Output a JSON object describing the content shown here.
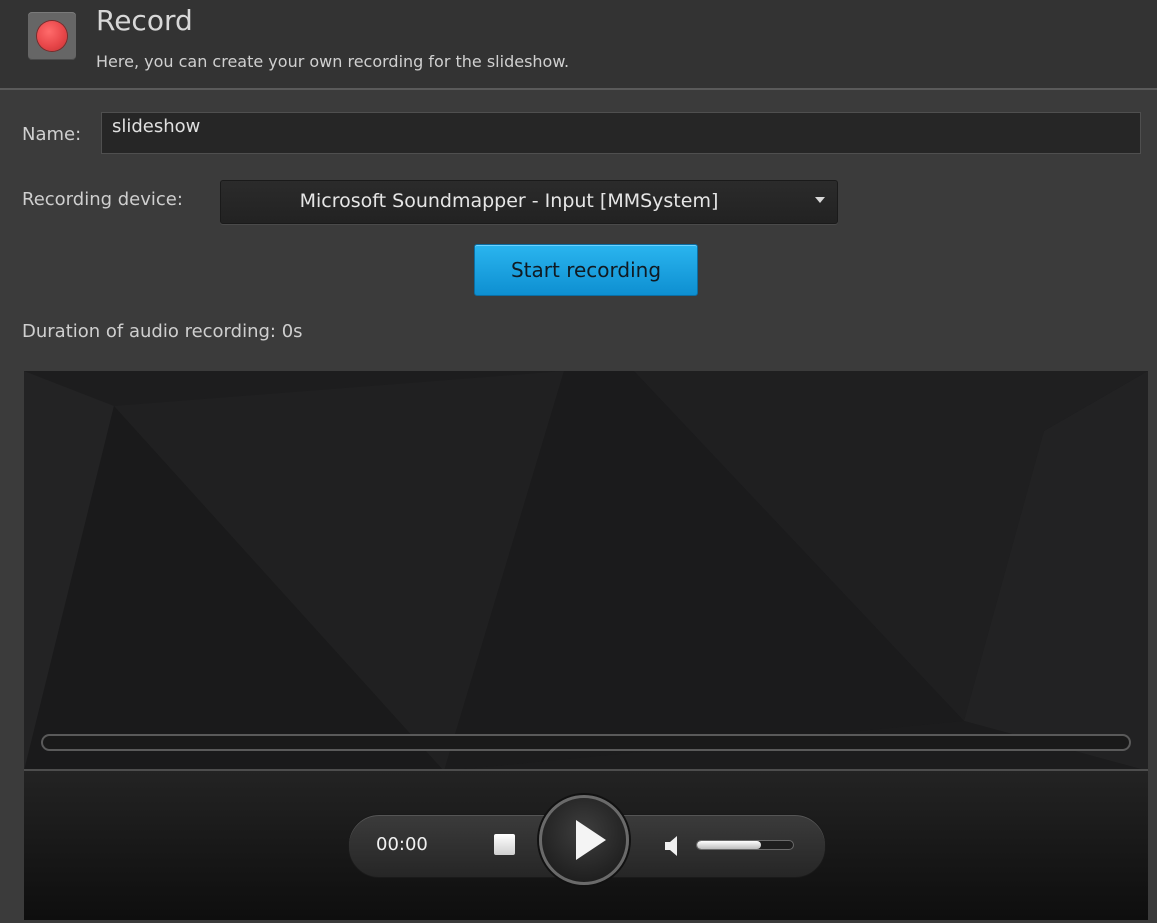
{
  "header": {
    "title": "Record",
    "subtitle": "Here, you can create your own recording for the slideshow."
  },
  "form": {
    "name_label": "Name:",
    "name_value": "slideshow",
    "device_label": "Recording device:",
    "device_value": "Microsoft Soundmapper - Input [MMSystem]",
    "start_button": "Start recording",
    "duration_label": "Duration of audio recording:",
    "duration_value": "0s"
  },
  "player": {
    "time": "00:00",
    "volume_level": 0.67
  },
  "icons": {
    "header": "record-icon",
    "stop": "stop-icon",
    "play": "play-icon",
    "volume": "speaker-icon",
    "dropdown": "chevron-down-icon"
  },
  "colors": {
    "record_red": "#e8474a",
    "accent_blue": "#1aa3e0"
  }
}
